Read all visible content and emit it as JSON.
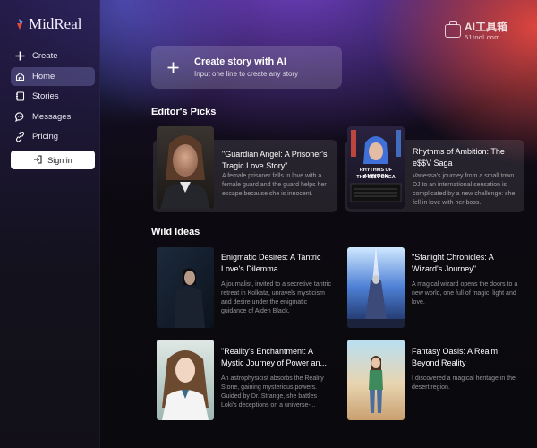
{
  "brand": {
    "name": "MidReal",
    "accent": "#e24a3b"
  },
  "watermark": {
    "title": "AI工具箱",
    "url": "51tool.com"
  },
  "sidebar": {
    "items": [
      {
        "label": "Create",
        "icon": "plus-icon",
        "active": false
      },
      {
        "label": "Home",
        "icon": "home-icon",
        "active": true
      },
      {
        "label": "Stories",
        "icon": "book-icon",
        "active": false
      },
      {
        "label": "Messages",
        "icon": "chat-icon",
        "active": false
      },
      {
        "label": "Pricing",
        "icon": "tag-icon",
        "active": false
      }
    ],
    "signin_label": "Sign in"
  },
  "create": {
    "title": "Create story with AI",
    "subtitle": "Input one line to create any story"
  },
  "editors_picks": {
    "title": "Editor's Picks",
    "cards": [
      {
        "title": "\"Guardian Angel: A Prisoner's Tragic Love Story\"",
        "desc": "A female prisoner falls in love with a female guard and the guard helps her escape because she is innocent."
      },
      {
        "title": "Rhythms of Ambition: The e$$V Saga",
        "desc": "Vanessa's journey from a small town DJ to an international sensation is complicated by a new challenge: she fell in love with her boss.",
        "cover_text": [
          "RHYTHMS OF AMBITION",
          "THE E$$V SAGA"
        ]
      }
    ]
  },
  "wild_ideas": {
    "title": "Wild Ideas",
    "cards": [
      {
        "title": "Enigmatic Desires: A Tantric Love's Dilemma",
        "desc": "A journalist, invited to a secretive tantric retreat in Kolkata, unravels mysticism and desire under the enigmatic guidance of Aiden Black."
      },
      {
        "title": "\"Starlight Chronicles: A Wizard's Journey\"",
        "desc": "A magical wizard opens the doors to a new world, one full of magic, light and love."
      },
      {
        "title": "\"Reality's Enchantment: A Mystic Journey of Power an...",
        "desc": "An astrophysicist absorbs the Reality Stone, gaining mysterious powers. Guided by Dr. Strange, she battles Loki's deceptions on a universe-..."
      },
      {
        "title": "Fantasy Oasis: A Realm Beyond Reality",
        "desc": "I discovered a magical heritage in the desert region."
      }
    ]
  }
}
